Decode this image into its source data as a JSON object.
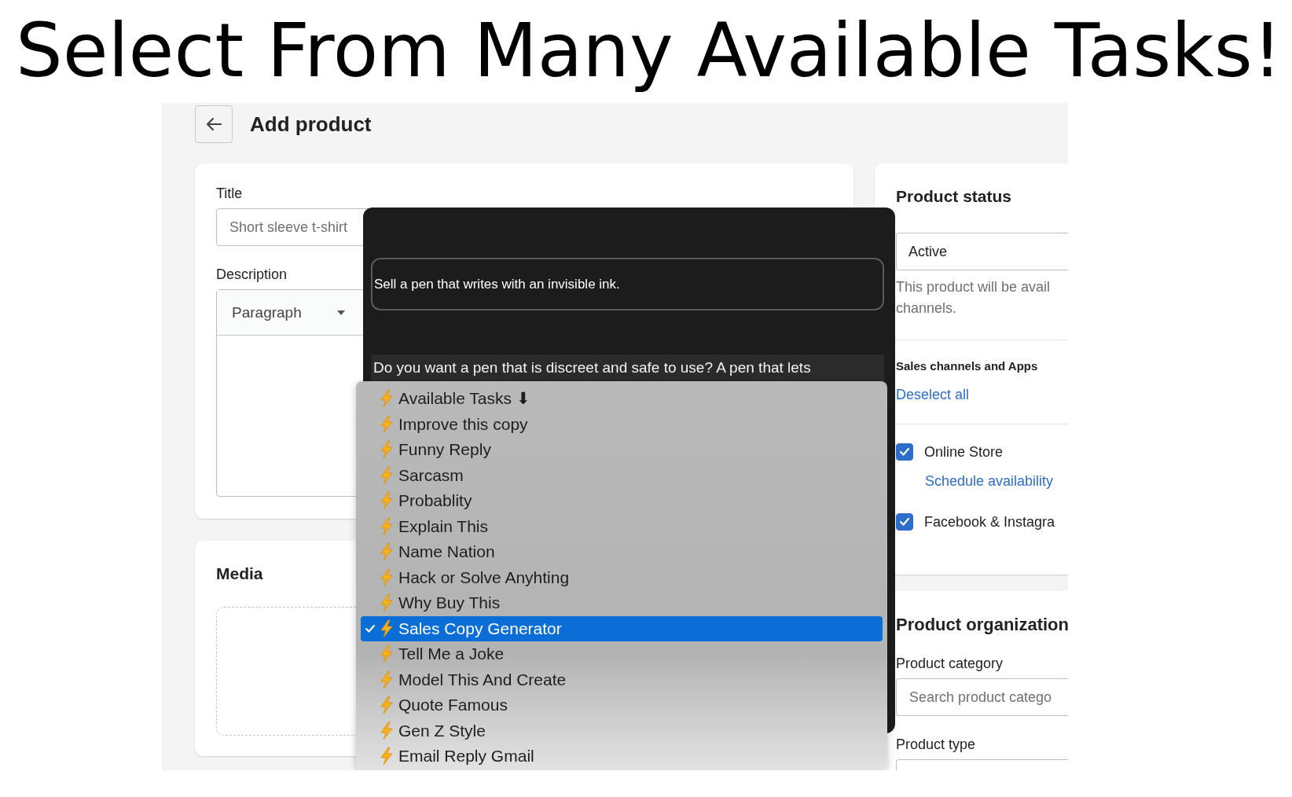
{
  "headline": "Select From Many Available Tasks!",
  "page": {
    "title": "Add product"
  },
  "product_form": {
    "title_label": "Title",
    "title_placeholder": "Short sleeve t-shirt",
    "description_label": "Description",
    "format_select": "Paragraph"
  },
  "media": {
    "title": "Media"
  },
  "product_status": {
    "title": "Product status",
    "status_select": "Active",
    "help_lines": [
      "This product will be avail",
      "channels."
    ],
    "channels_title": "Sales channels and Apps",
    "deselect_link": "Deselect all",
    "channels": [
      {
        "name": "Online Store",
        "checked": true,
        "link": "Schedule availability"
      },
      {
        "name": "Facebook & Instagra",
        "checked": true
      }
    ]
  },
  "organization": {
    "title": "Product organization",
    "category_label": "Product category",
    "category_placeholder": "Search product catego",
    "type_label": "Product type"
  },
  "ai_popup": {
    "prompt": "Sell a pen that writes with an invisible ink.",
    "response": "Do you want a pen that is discreet and safe to use? A pen that lets"
  },
  "task_menu": {
    "items": [
      {
        "label": "Available Tasks ⬇",
        "selected": false
      },
      {
        "label": "Improve this copy",
        "selected": false
      },
      {
        "label": "Funny Reply",
        "selected": false
      },
      {
        "label": "Sarcasm",
        "selected": false
      },
      {
        "label": "Probablity",
        "selected": false
      },
      {
        "label": "Explain This",
        "selected": false
      },
      {
        "label": "Name Nation",
        "selected": false
      },
      {
        "label": "Hack or Solve Anyhting",
        "selected": false
      },
      {
        "label": "Why Buy This",
        "selected": false
      },
      {
        "label": "Sales Copy Generator",
        "selected": true
      },
      {
        "label": "Tell Me a Joke",
        "selected": false
      },
      {
        "label": "Model This And Create",
        "selected": false
      },
      {
        "label": "Quote Famous",
        "selected": false
      },
      {
        "label": "Gen Z Style",
        "selected": false
      },
      {
        "label": "Email Reply Gmail",
        "selected": false
      }
    ]
  }
}
